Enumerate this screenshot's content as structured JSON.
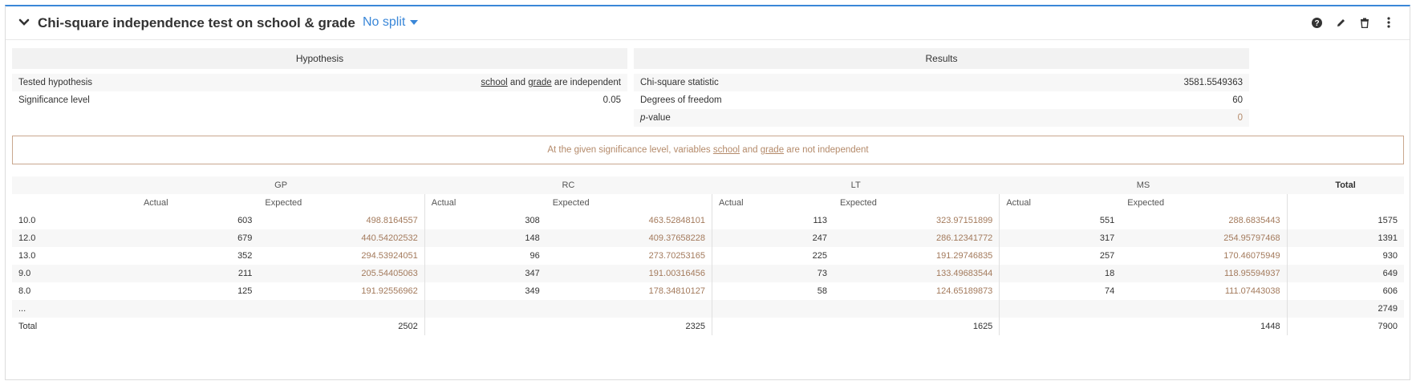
{
  "header": {
    "title": "Chi-square independence test on school & grade",
    "split_label": "No split",
    "tools": [
      "help-icon",
      "edit-icon",
      "delete-icon",
      "more-icon"
    ]
  },
  "hypothesis": {
    "title": "Hypothesis",
    "rows": [
      {
        "label": "Tested hypothesis",
        "value_parts": [
          "school",
          " and ",
          "grade",
          " are independent"
        ]
      },
      {
        "label": "Significance level",
        "value": "0.05"
      }
    ]
  },
  "results": {
    "title": "Results",
    "rows": [
      {
        "label": "Chi-square statistic",
        "value": "3581.5549363"
      },
      {
        "label": "Degrees of freedom",
        "value": "60"
      },
      {
        "label_italic": "p",
        "label_rest": "-value",
        "value": "0"
      }
    ]
  },
  "conclusion": {
    "prefix": "At the given significance level, variables ",
    "var1": "school",
    "middle": " and ",
    "var2": "grade",
    "suffix": " are not independent"
  },
  "table": {
    "groups": [
      "GP",
      "RC",
      "LT",
      "MS"
    ],
    "total_label": "Total",
    "actual_label": "Actual",
    "expected_label": "Expected",
    "rows": [
      {
        "label": "10.0",
        "cells": [
          "603",
          "498.8164557",
          "308",
          "463.52848101",
          "113",
          "323.97151899",
          "551",
          "288.6835443"
        ],
        "total": "1575"
      },
      {
        "label": "12.0",
        "cells": [
          "679",
          "440.54202532",
          "148",
          "409.37658228",
          "247",
          "286.12341772",
          "317",
          "254.95797468"
        ],
        "total": "1391"
      },
      {
        "label": "13.0",
        "cells": [
          "352",
          "294.53924051",
          "96",
          "273.70253165",
          "225",
          "191.29746835",
          "257",
          "170.46075949"
        ],
        "total": "930"
      },
      {
        "label": "9.0",
        "cells": [
          "211",
          "205.54405063",
          "347",
          "191.00316456",
          "73",
          "133.49683544",
          "18",
          "118.95594937"
        ],
        "total": "649"
      },
      {
        "label": "8.0",
        "cells": [
          "125",
          "191.92556962",
          "349",
          "178.34810127",
          "58",
          "124.65189873",
          "74",
          "111.07443038"
        ],
        "total": "606"
      },
      {
        "label": "...",
        "cells": [
          "",
          "",
          "",
          "",
          "",
          "",
          "",
          ""
        ],
        "total": "2749"
      }
    ],
    "totals_row": {
      "label": "Total",
      "values": [
        "2502",
        "2325",
        "1625",
        "1448"
      ],
      "grand_total": "7900"
    }
  }
}
